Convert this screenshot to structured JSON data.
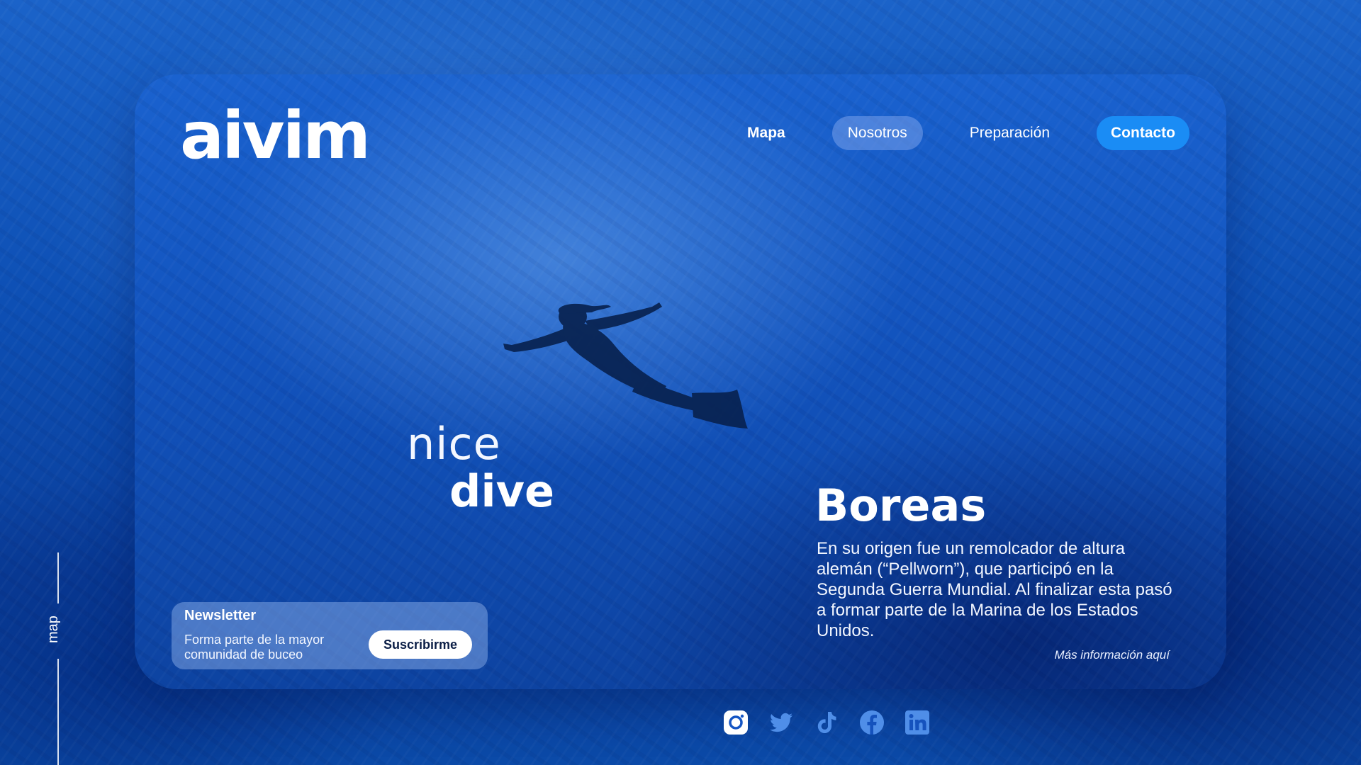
{
  "brand": {
    "logo_text": "aivim"
  },
  "nav": {
    "items": [
      {
        "label": "Mapa",
        "style": "bold"
      },
      {
        "label": "Nosotros",
        "style": "pill"
      },
      {
        "label": "Preparación",
        "style": "plain"
      },
      {
        "label": "Contacto",
        "style": "cta"
      }
    ]
  },
  "hero": {
    "line1": "nice",
    "line2": "dive"
  },
  "feature": {
    "title": "Boreas",
    "description": "En su origen fue un remolcador de altura alemán (“Pellworn”), que participó en la Segunda Guerra Mundial. Al finalizar esta pasó a formar parte de la Marina de los Estados Unidos.",
    "link": "Más información aquí"
  },
  "newsletter": {
    "title": "Newsletter",
    "text": "Forma parte de la mayor comunidad de buceo",
    "button": "Suscribirme"
  },
  "side": {
    "label": "map"
  },
  "socials": [
    {
      "icon": "instagram-icon"
    },
    {
      "icon": "twitter-icon"
    },
    {
      "icon": "tiktok-icon"
    },
    {
      "icon": "facebook-icon"
    },
    {
      "icon": "linkedin-icon"
    }
  ],
  "colors": {
    "background": "#0d4fb4",
    "accent": "#1a8cf5",
    "pill": "#7aa0eb",
    "button_text": "#0b1e46",
    "social_active": "#ffffff",
    "social_muted": "#4f8ee8"
  }
}
